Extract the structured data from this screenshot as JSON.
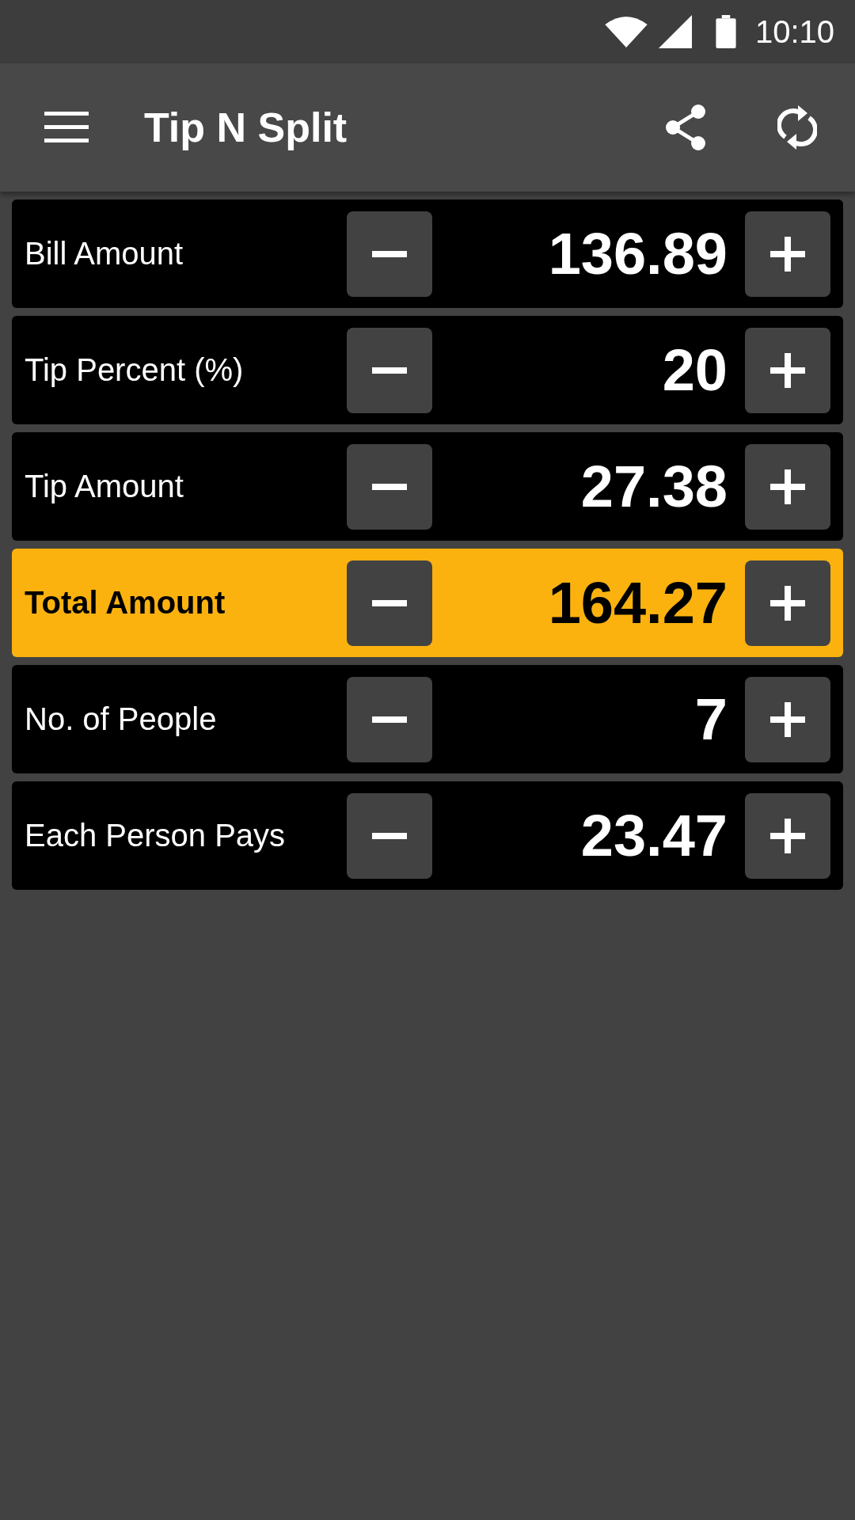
{
  "status_bar": {
    "time": "10:10"
  },
  "app_bar": {
    "title": "Tip N Split"
  },
  "rows": [
    {
      "label": "Bill Amount",
      "value": "136.89",
      "highlighted": false
    },
    {
      "label": "Tip Percent (%)",
      "value": "20",
      "highlighted": false
    },
    {
      "label": "Tip Amount",
      "value": "27.38",
      "highlighted": false
    },
    {
      "label": "Total Amount",
      "value": "164.27",
      "highlighted": true
    },
    {
      "label": "No. of People",
      "value": "7",
      "highlighted": false
    },
    {
      "label": "Each Person Pays",
      "value": "23.47",
      "highlighted": false
    }
  ]
}
